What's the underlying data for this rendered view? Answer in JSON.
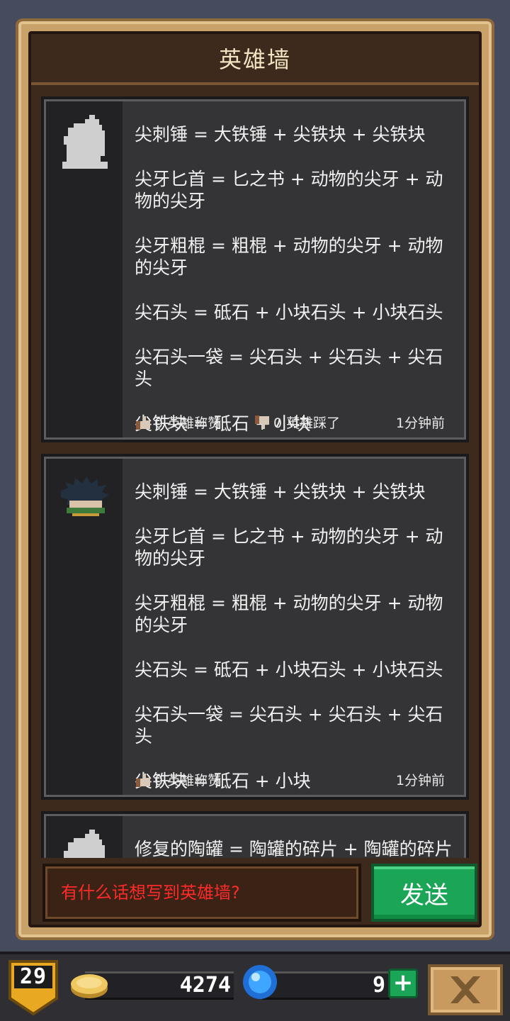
{
  "title": "英雄墙",
  "posts": [
    {
      "avatar": "hooded-silhouette-avatar",
      "lines": [
        "尖刺锤 = 大铁锤 + 尖铁块 + 尖铁块",
        "尖牙匕首 = 匕之书 + 动物的尖牙 + 动物的尖牙",
        "尖牙粗棍 = 粗棍 + 动物的尖牙 + 动物的尖牙",
        "尖石头 = 砥石 + 小块石头 + 小块石头",
        "尖石头一袋 = 尖石头 + 尖石头 + 尖石头",
        "尖铁块 = 砥石 + 小块"
      ],
      "likes": "0 英雄称赞",
      "dislikes": "0 英雄踩了",
      "time": "1分钟前"
    },
    {
      "avatar": "spiky-hair-hero-avatar",
      "lines": [
        "尖刺锤 = 大铁锤 + 尖铁块 + 尖铁块",
        "尖牙匕首 = 匕之书 + 动物的尖牙 + 动物的尖牙",
        "尖牙粗棍 = 粗棍 + 动物的尖牙 + 动物的尖牙",
        "尖石头 = 砥石 + 小块石头 + 小块石头",
        "尖石头一袋 = 尖石头 + 尖石头 + 尖石头",
        "尖铁块 = 砥石 + 小块"
      ],
      "likes": "0 英雄称赞",
      "time": "1分钟前"
    },
    {
      "avatar": "hooded-silhouette-avatar",
      "lines": [
        "修复的陶罐 = 陶罐的碎片 + 陶罐的碎片"
      ]
    }
  ],
  "input": {
    "placeholder": "有什么话想写到英雄墙?"
  },
  "send_label": "发送",
  "status": {
    "level": "29",
    "coins": "4274",
    "gems": "9",
    "plus_label": "+"
  },
  "colors": {
    "frame": "#c9a26a",
    "panel": "#3d2a1c",
    "card": "#343436",
    "accent_green": "#1aa557",
    "placeholder_red": "#ff2a2a"
  }
}
